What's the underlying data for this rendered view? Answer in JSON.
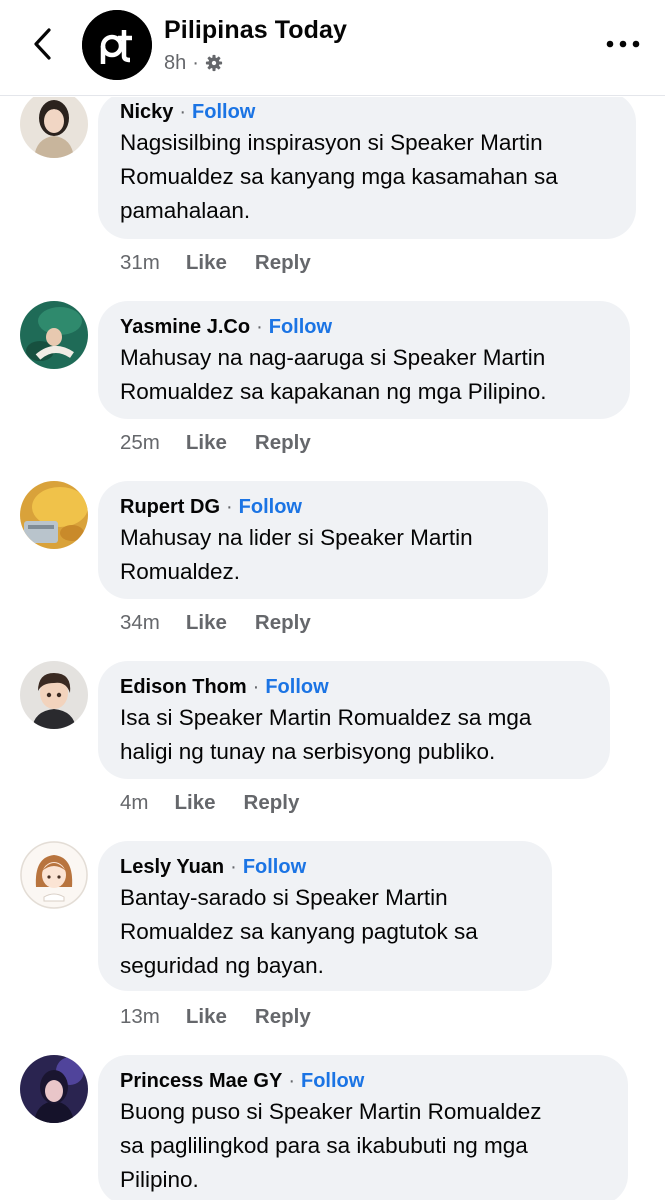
{
  "header": {
    "page_name": "Pilipinas Today",
    "logo_text": "pt",
    "time": "8h",
    "separator": "·",
    "privacy_icon": "gear-icon",
    "back_icon": "chevron-left-icon",
    "more_icon": "more-horizontal-icon"
  },
  "labels": {
    "follow": "Follow",
    "like": "Like",
    "reply": "Reply",
    "separator": "·"
  },
  "colors": {
    "follow": "#1b74e4",
    "bubble": "#f0f2f5",
    "secondary_text": "#65676b"
  },
  "comments": [
    {
      "author": "Nicky",
      "text_lines": [
        "Nagsisilbing inspirasyon si Speaker Martin",
        "Romualdez sa kanyang mga kasamahan sa",
        "pamahalaan."
      ],
      "time": "31m"
    },
    {
      "author": "Yasmine J.Co",
      "text_lines": [
        "Mahusay na nag-aaruga si Speaker Martin",
        "Romualdez sa kapakanan ng mga Pilipino."
      ],
      "time": "25m"
    },
    {
      "author": "Rupert DG",
      "text_lines": [
        "Mahusay na lider si Speaker Martin",
        "Romualdez."
      ],
      "time": "34m"
    },
    {
      "author": "Edison Thom",
      "text_lines": [
        "Isa si Speaker Martin Romualdez sa mga",
        "haligi ng tunay na serbisyong publiko."
      ],
      "time": "4m"
    },
    {
      "author": "Lesly Yuan",
      "text_lines": [
        "Bantay-sarado si Speaker Martin",
        "Romualdez sa kanyang pagtutok sa",
        "seguridad ng bayan."
      ],
      "time": "13m"
    },
    {
      "author": "Princess Mae GY",
      "text_lines": [
        "Buong puso si Speaker Martin Romualdez",
        "sa paglilingkod para sa ikabubuti ng mga",
        "Pilipino."
      ],
      "time": ""
    }
  ]
}
